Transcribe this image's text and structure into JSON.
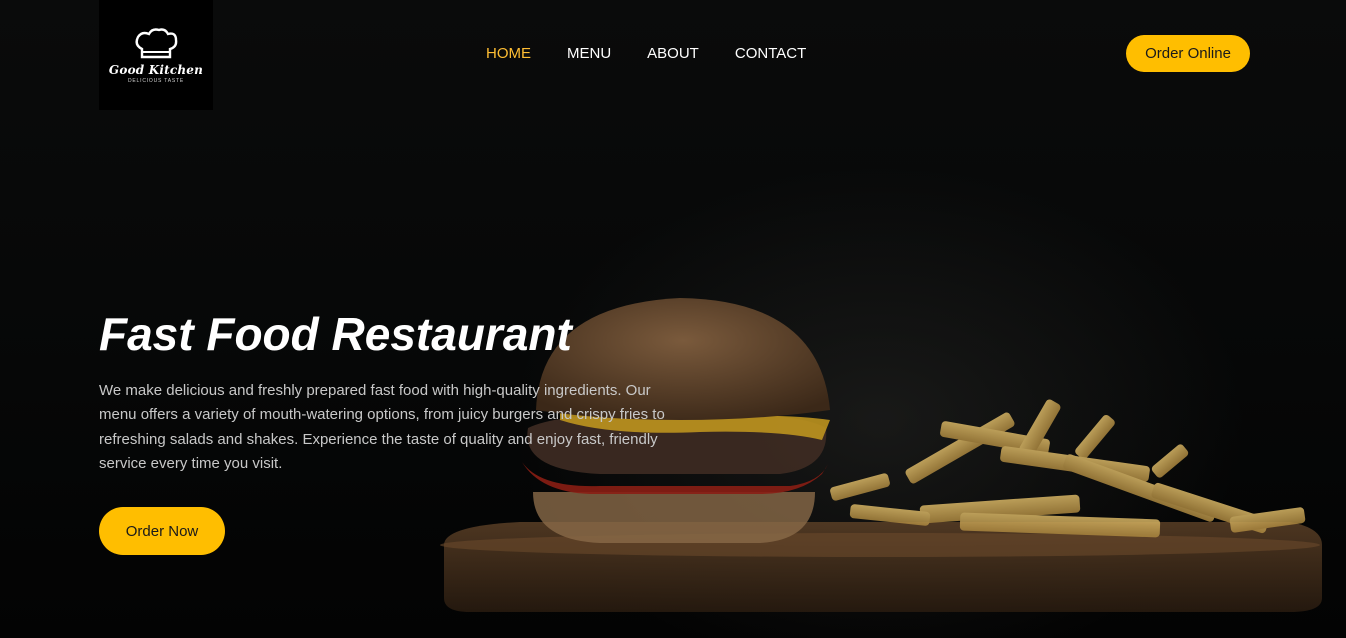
{
  "brand": {
    "name": "Good Kitchen",
    "tagline": "DELICIOUS TASTE"
  },
  "nav": {
    "items": [
      {
        "label": "HOME",
        "active": true
      },
      {
        "label": "MENU",
        "active": false
      },
      {
        "label": "ABOUT",
        "active": false
      },
      {
        "label": "CONTACT",
        "active": false
      }
    ]
  },
  "header": {
    "order_online_label": "Order Online"
  },
  "hero": {
    "title": "Fast Food Restaurant",
    "description": "We make delicious and freshly prepared fast food with high-quality ingredients. Our menu offers a variety of mouth-watering options, from juicy burgers and crispy fries to refreshing salads and shakes. Experience the taste of quality and enjoy fast, friendly service every time you visit.",
    "order_now_label": "Order Now",
    "image_icon": "burger-and-fries-photo"
  },
  "colors": {
    "accent": "#ffbe00",
    "active_nav": "#ffbe33",
    "background": "#050606",
    "text_muted": "#c8c8c8"
  }
}
